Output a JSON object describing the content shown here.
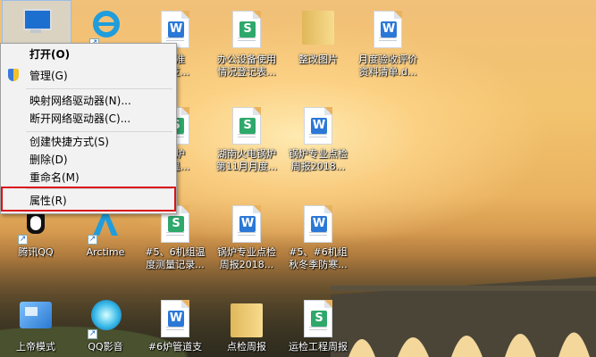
{
  "context_menu": {
    "items": [
      {
        "label": "打开(O)",
        "bold": true
      },
      {
        "label": "管理(G)"
      },
      {
        "label": "映射网络驱动器(N)..."
      },
      {
        "label": "断开网络驱动器(C)..."
      },
      {
        "label": "创建快捷方式(S)"
      },
      {
        "label": "删除(D)"
      },
      {
        "label": "重命名(M)"
      },
      {
        "label": "属性(R)"
      }
    ],
    "highlight_color": "#d9121a"
  },
  "desktop": {
    "icons": [
      {
        "label": "",
        "type": "ie"
      },
      {
        "label": "",
        "type": "word"
      },
      {
        "label": "",
        "type": "excel"
      },
      {
        "label": "",
        "type": "folder"
      },
      {
        "label": "",
        "type": "word"
      },
      {
        "label": "标准\n...支...",
        "type": "word"
      },
      {
        "label": "办公设备使用\n情况登记表...",
        "type": "excel"
      },
      {
        "label": "整改图片",
        "type": "folder"
      },
      {
        "label": "月度验收评价\n资料清单.d...",
        "type": "word"
      },
      {
        "label": "锅炉\n保温...",
        "type": "excel"
      },
      {
        "label": "湖南火电锅炉\n第11月月度...",
        "type": "excel"
      },
      {
        "label": "锅炉专业点检\n周报2018...",
        "type": "word"
      },
      {
        "label": "腾讯QQ",
        "type": "qq"
      },
      {
        "label": "Arctime",
        "type": "arctime"
      },
      {
        "label": "#5、6机组温\n度测量记录...",
        "type": "excel"
      },
      {
        "label": "锅炉专业点检\n周报2018...",
        "type": "word"
      },
      {
        "label": "#5、#6机组\n秋冬季防寒...",
        "type": "word"
      },
      {
        "label": "上帝模式",
        "type": "god"
      },
      {
        "label": "QQ影音",
        "type": "qqplayer"
      },
      {
        "label": "#6炉管道支",
        "type": "word"
      },
      {
        "label": "点检周报",
        "type": "folder"
      },
      {
        "label": "运检工程周报",
        "type": "excel"
      }
    ]
  },
  "colors": {
    "word": "#2b78d6",
    "excel": "#2ea86b",
    "ie": "#1f9ddc"
  }
}
